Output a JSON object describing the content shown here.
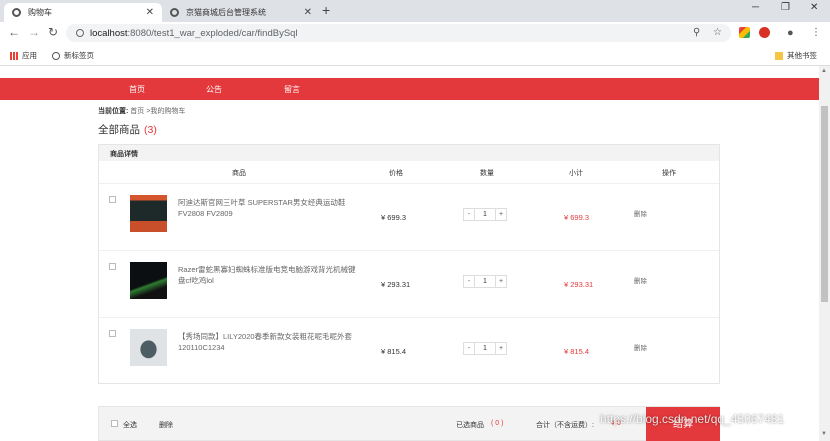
{
  "tabs": [
    {
      "title": "购物车",
      "active": true
    },
    {
      "title": "京猫商城后台管理系统",
      "active": false
    }
  ],
  "address": {
    "host": "localhost",
    "path": ":8080/test1_war_exploded/car/findBySql"
  },
  "bookmarks": {
    "apps": "应用",
    "newtab": "新标签页",
    "other": "其他书签"
  },
  "nav": [
    "首页",
    "公告",
    "留言"
  ],
  "breadcrumb": {
    "label": "当前位置:",
    "path": "首页 >我的购物车"
  },
  "cart_heading": {
    "title": "全部商品",
    "count": "(3)"
  },
  "cart": {
    "section_title": "商品详情",
    "columns": {
      "product": "商品",
      "price": "价格",
      "qty": "数量",
      "subtotal": "小计",
      "action": "操作"
    },
    "items": [
      {
        "name": "阿迪达斯官网三叶草 SUPERSTAR男女经典运动鞋FV2808 FV2809",
        "price": "¥ 699.3",
        "qty": "1",
        "subtotal": "¥ 699.3",
        "delete": "删除"
      },
      {
        "name": "Razer雷蛇黑寡妇蜘蛛标准版电竞电脑游戏背光机械键盘cf吃鸡lol",
        "price": "¥ 293.31",
        "qty": "1",
        "subtotal": "¥ 293.31",
        "delete": "删除"
      },
      {
        "name": "【秀场同款】LILY2020春季新款女装粗花呢毛呢外套120110C1234",
        "price": "¥ 815.4",
        "qty": "1",
        "subtotal": "¥ 815.4",
        "delete": "删除"
      }
    ],
    "minus": "-",
    "plus": "+"
  },
  "footer": {
    "select_all": "全选",
    "delete": "删除",
    "selected_label": "已选商品",
    "selected_count": "( 0 )",
    "total_label": "合计（不含运费）:",
    "total_value": "¥ 0",
    "settle": "结算"
  },
  "watermark": "https://blog.csdn.net/qq_45067481",
  "colors": {
    "accent": "#e4393c"
  }
}
